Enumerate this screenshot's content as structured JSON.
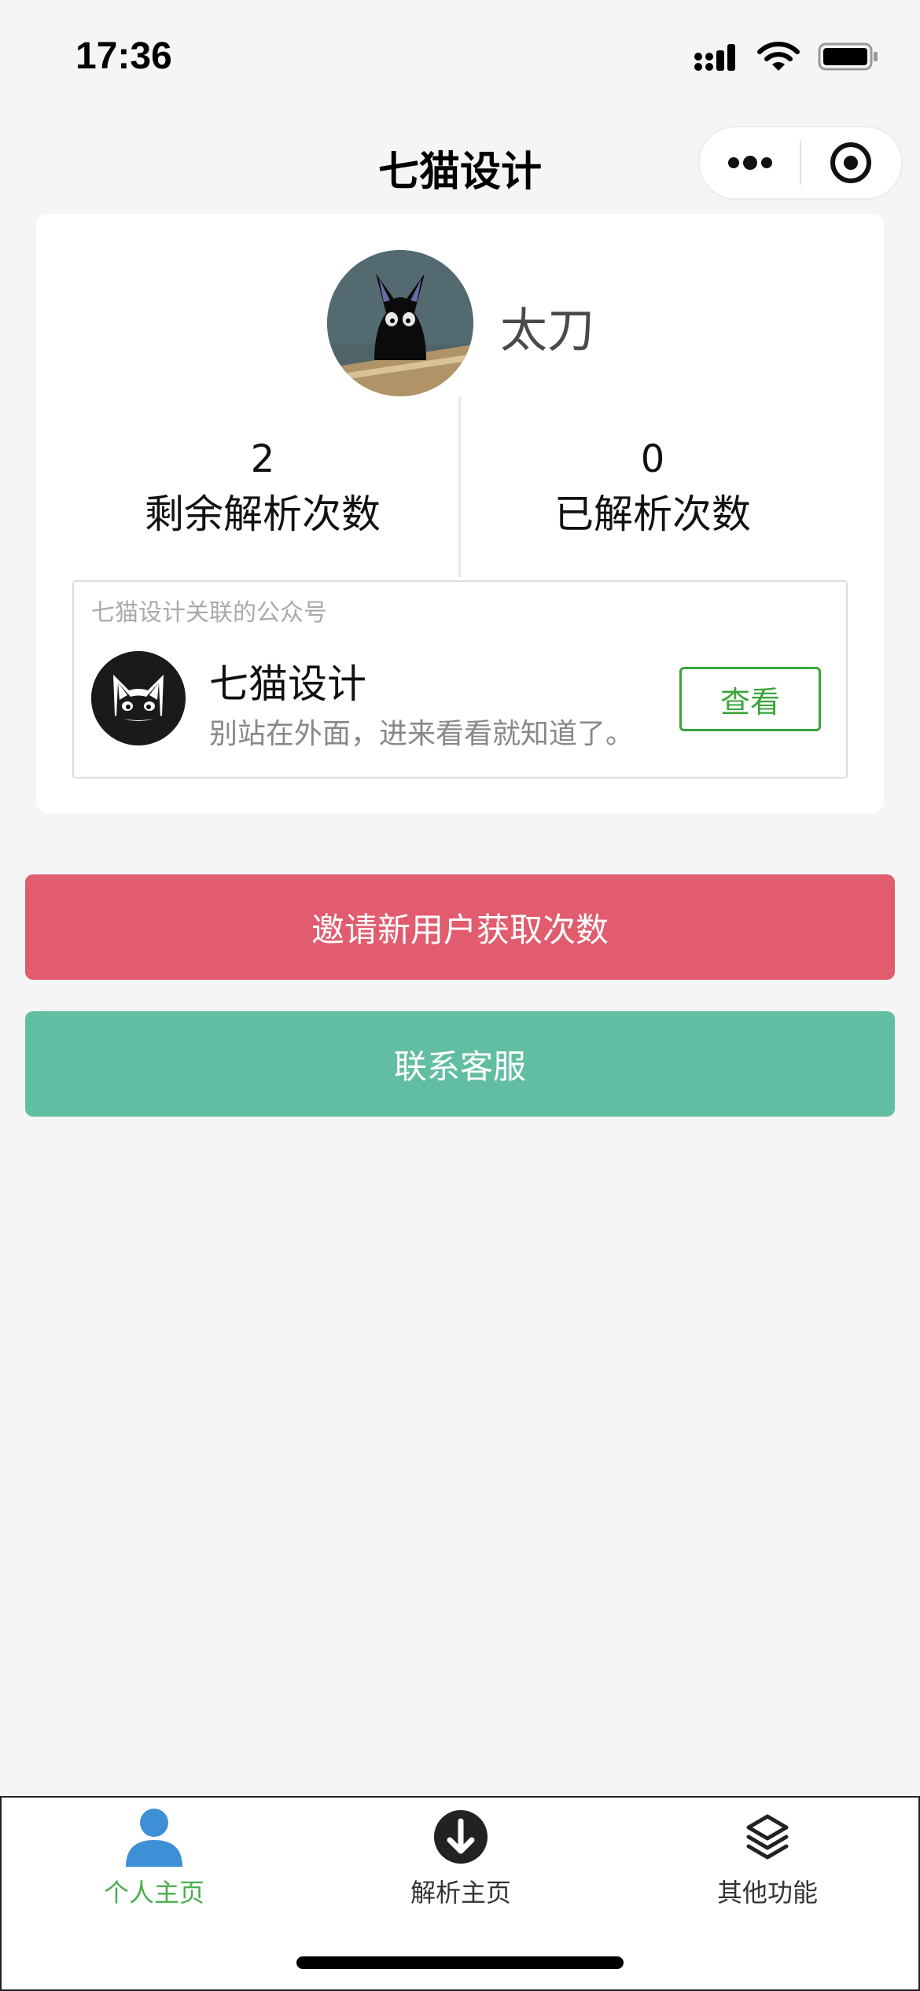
{
  "status_bar": {
    "time": "17:36"
  },
  "nav": {
    "title": "七猫设计"
  },
  "profile": {
    "username": "太刀",
    "stats": [
      {
        "value": "2",
        "label": "剩余解析次数"
      },
      {
        "value": "0",
        "label": "已解析次数"
      }
    ]
  },
  "official_account": {
    "caption": "七猫设计关联的公众号",
    "name": "七猫设计",
    "description": "别站在外面，进来看看就知道了。",
    "view_label": "查看"
  },
  "actions": {
    "invite_label": "邀请新用户获取次数",
    "contact_label": "联系客服"
  },
  "tabs": [
    {
      "label": "个人主页",
      "icon": "person-icon",
      "active": true
    },
    {
      "label": "解析主页",
      "icon": "download-circle-icon",
      "active": false
    },
    {
      "label": "其他功能",
      "icon": "layers-icon",
      "active": false
    }
  ],
  "colors": {
    "invite": "#e05c6e",
    "contact": "#62bea2",
    "accent_green": "#3aa53a",
    "tab_active": "#4cae4c",
    "tab_icon_active": "#3f8fd6"
  }
}
